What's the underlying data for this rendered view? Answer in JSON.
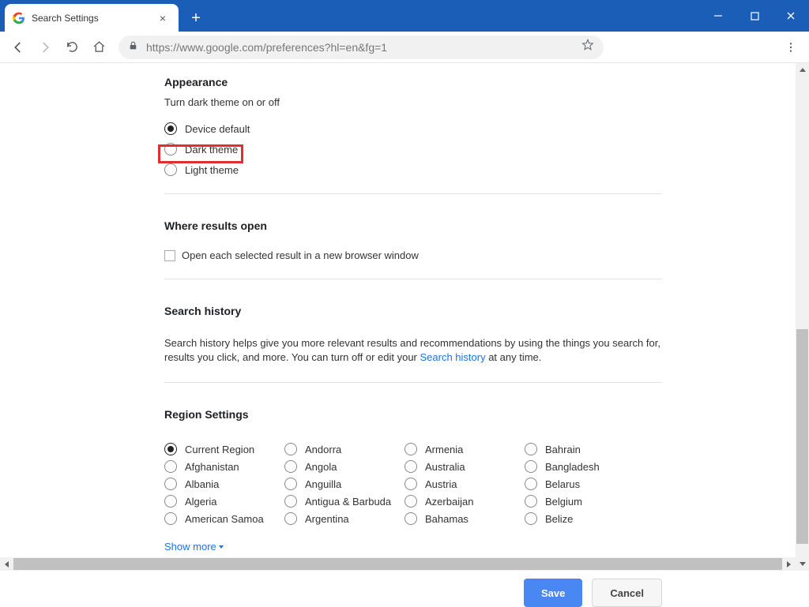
{
  "browser": {
    "tab_title": "Search Settings",
    "url_display": "https://www.google.com/preferences?hl=en&fg=1"
  },
  "appearance": {
    "heading": "Appearance",
    "subtitle": "Turn dark theme on or off",
    "options": [
      {
        "label": "Device default",
        "selected": true
      },
      {
        "label": "Dark theme",
        "selected": false
      },
      {
        "label": "Light theme",
        "selected": false
      }
    ]
  },
  "results_open": {
    "heading": "Where results open",
    "checkbox_label": "Open each selected result in a new browser window",
    "checked": false
  },
  "search_history": {
    "heading": "Search history",
    "text_before": "Search history helps give you more relevant results and recommendations by using the things you search for, results you click, and more. You can turn off or edit your ",
    "link_text": "Search history",
    "text_after": " at any time."
  },
  "region": {
    "heading": "Region Settings",
    "columns": [
      [
        "Current Region",
        "Afghanistan",
        "Albania",
        "Algeria",
        "American Samoa"
      ],
      [
        "Andorra",
        "Angola",
        "Anguilla",
        "Antigua & Barbuda",
        "Argentina"
      ],
      [
        "Armenia",
        "Australia",
        "Austria",
        "Azerbaijan",
        "Bahamas"
      ],
      [
        "Bahrain",
        "Bangladesh",
        "Belarus",
        "Belgium",
        "Belize"
      ]
    ],
    "selected": "Current Region",
    "show_more": "Show more"
  },
  "buttons": {
    "save": "Save",
    "cancel": "Cancel"
  },
  "annotations": {
    "highlight": "Dark theme option highlighted"
  }
}
